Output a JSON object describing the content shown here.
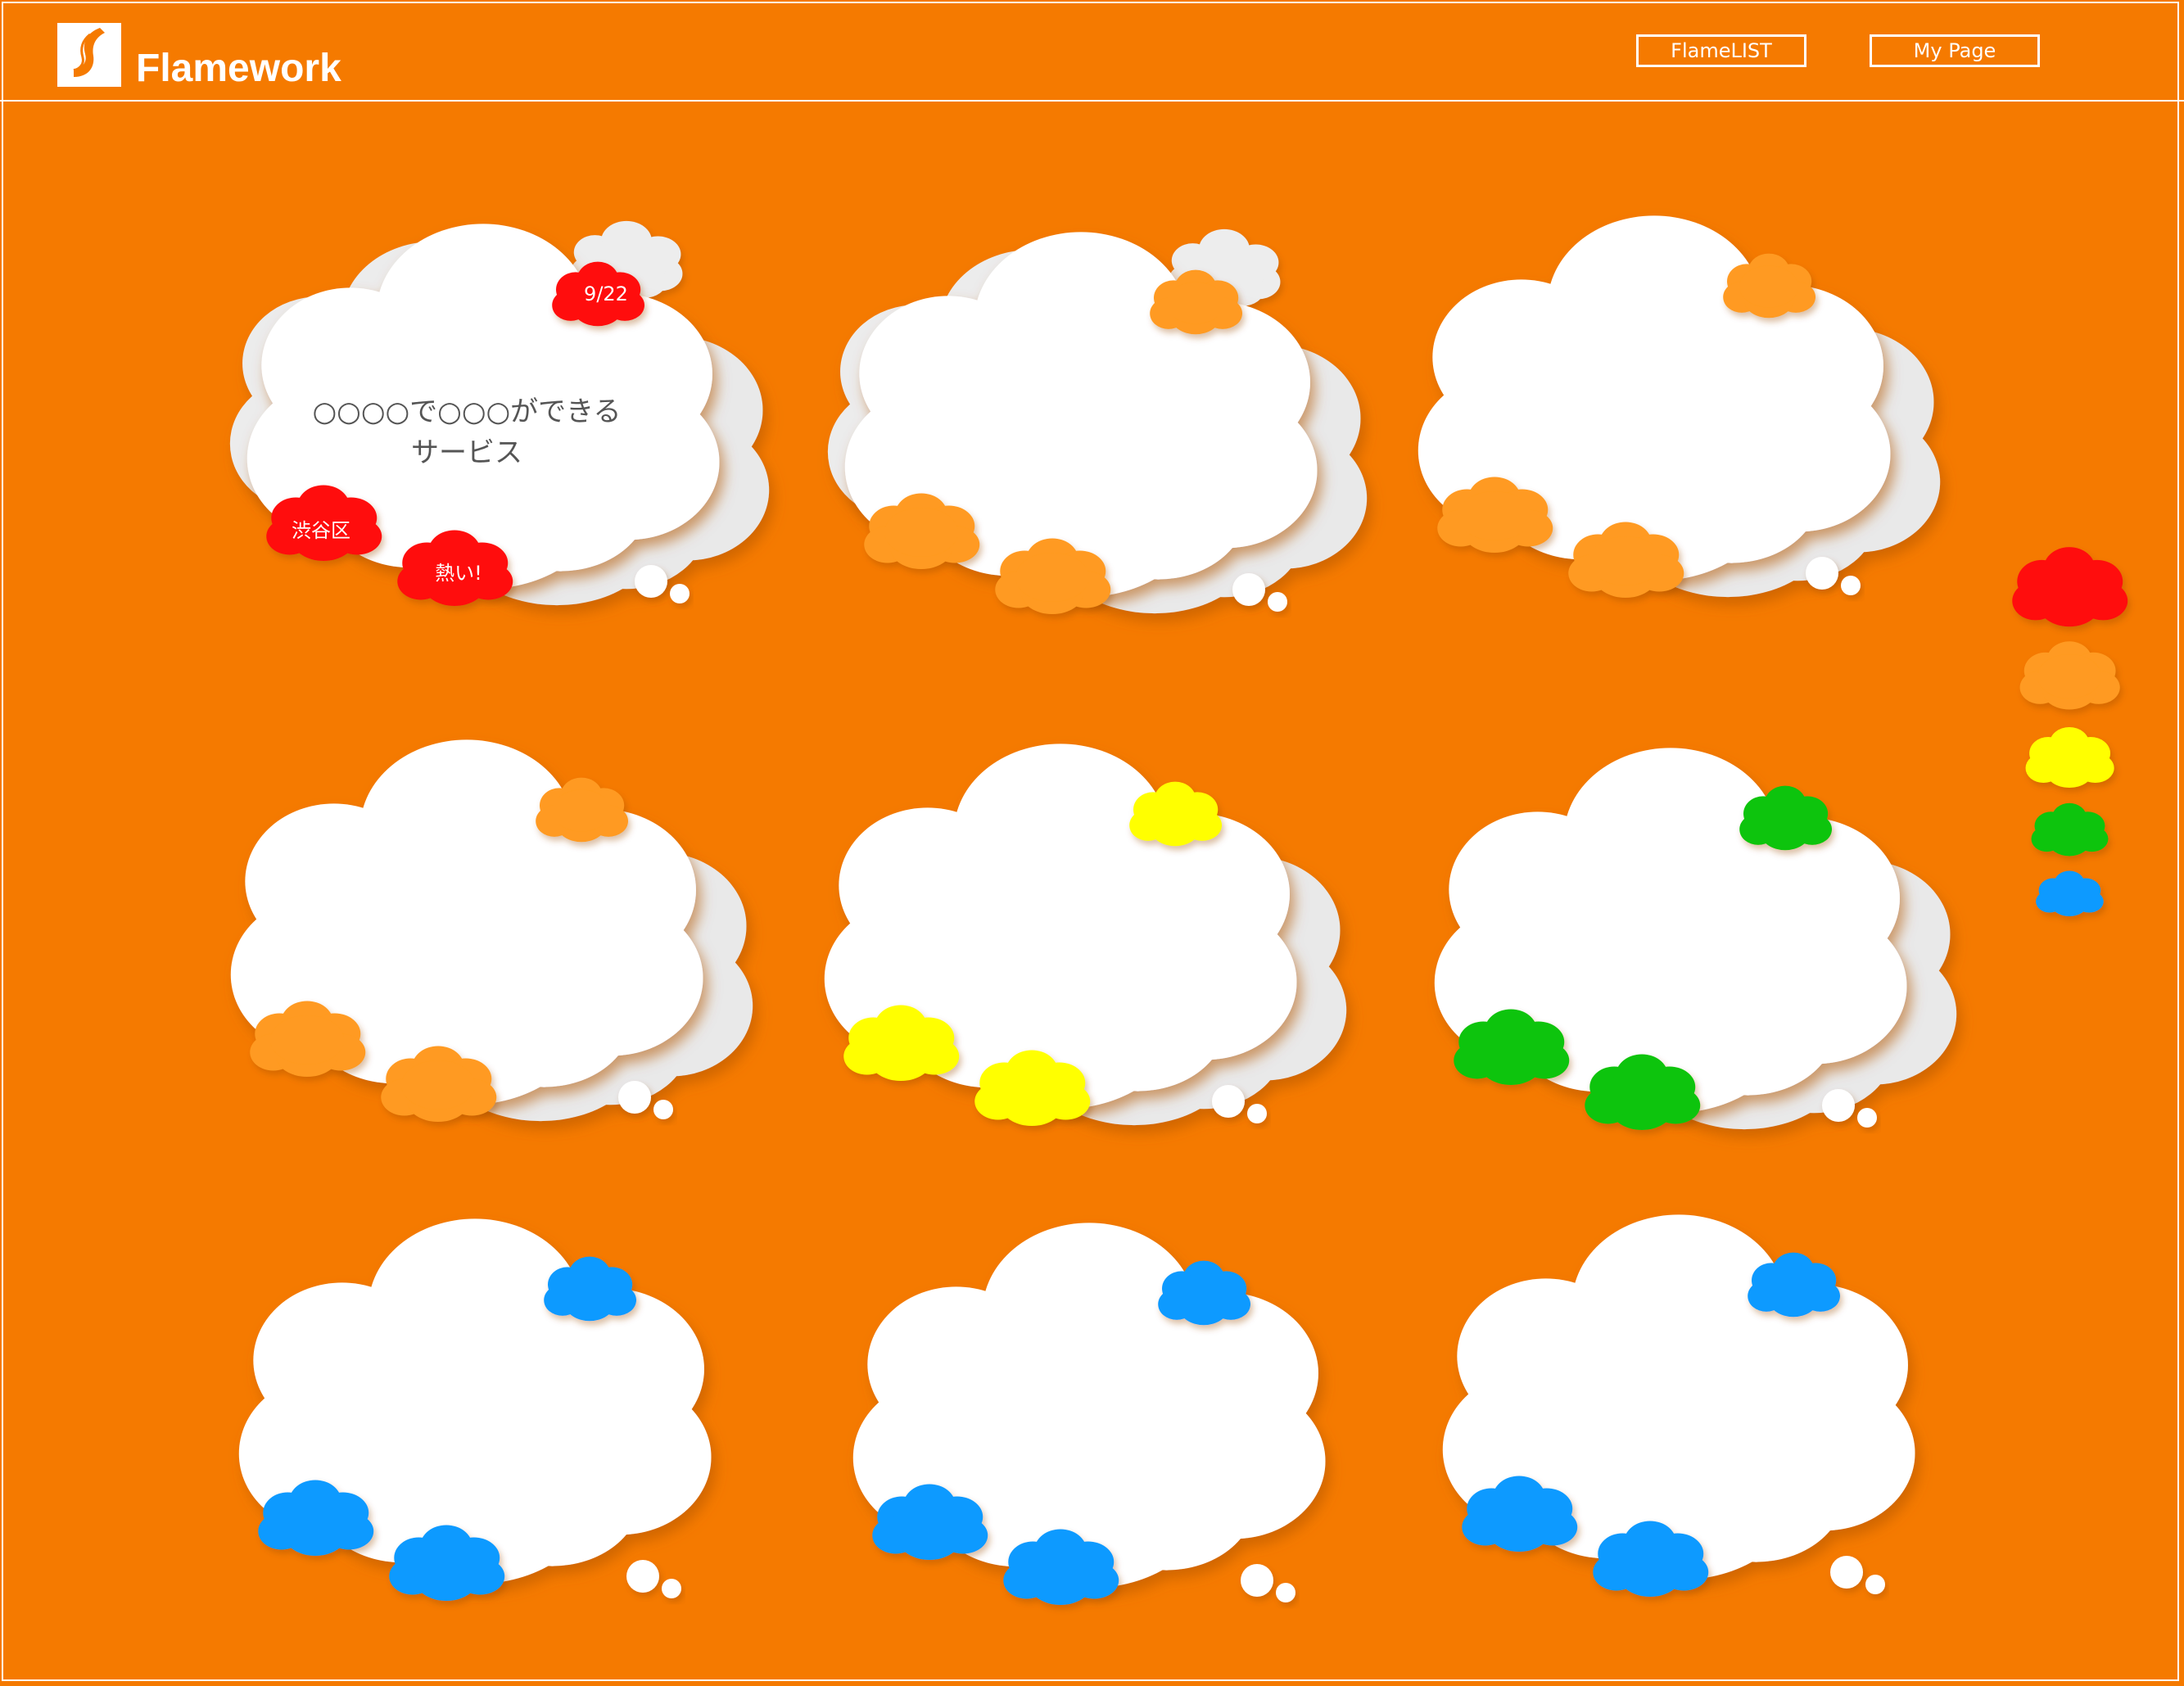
{
  "header": {
    "logo_text": "Flamework",
    "nav": [
      {
        "label": "FlameLIST"
      },
      {
        "label": "My Page"
      }
    ]
  },
  "featured_card": {
    "title_line1": "○○○○で○○○ができる",
    "title_line2": "サービス",
    "date_tag": "9/22",
    "location_tag": "渋谷区",
    "heat_tag": "熱い!"
  },
  "colors": {
    "background": "#f57a00",
    "red": "#ff1010",
    "orange": "#ff9a20",
    "yellow": "#ffff00",
    "green": "#0ac40a",
    "blue": "#0a9aff"
  },
  "card_tag_colors": [
    "red",
    "orange",
    "orange",
    "orange",
    "yellow",
    "green",
    "blue",
    "blue",
    "blue"
  ],
  "legend": [
    "red",
    "orange",
    "yellow",
    "green",
    "blue"
  ]
}
